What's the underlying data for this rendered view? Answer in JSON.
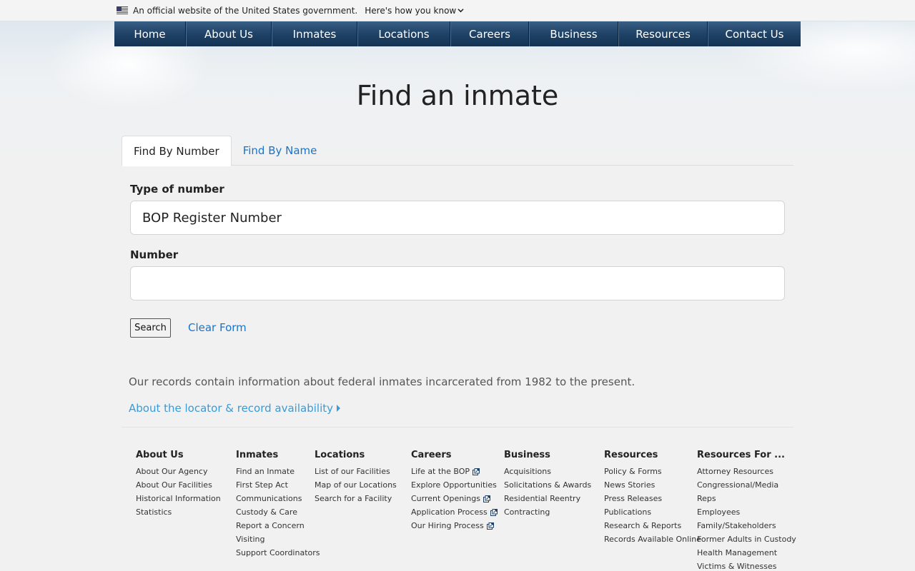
{
  "gov_banner": {
    "text": "An official website of the United States government.",
    "link": "Here's how you know"
  },
  "nav": [
    "Home",
    "About Us",
    "Inmates",
    "Locations",
    "Careers",
    "Business",
    "Resources",
    "Contact Us"
  ],
  "page_title": "Find an inmate",
  "tabs": {
    "by_number": "Find By Number",
    "by_name": "Find By Name"
  },
  "form": {
    "type_label": "Type of number",
    "type_value": "BOP Register Number",
    "number_label": "Number",
    "number_value": "",
    "search_button": "Search",
    "clear_link": "Clear Form"
  },
  "info": {
    "records": "Our records contain information about federal inmates incarcerated from 1982 to the present.",
    "locator_link": "About the locator & record availability"
  },
  "footer": [
    {
      "heading": "About Us",
      "links": [
        {
          "label": "About Our Agency"
        },
        {
          "label": "About Our Facilities"
        },
        {
          "label": "Historical Information"
        },
        {
          "label": "Statistics"
        }
      ]
    },
    {
      "heading": "Inmates",
      "links": [
        {
          "label": "Find an Inmate"
        },
        {
          "label": "First Step Act"
        },
        {
          "label": "Communications"
        },
        {
          "label": "Custody & Care"
        },
        {
          "label": "Report a Concern"
        },
        {
          "label": "Visiting"
        },
        {
          "label": "Support Coordinators"
        }
      ]
    },
    {
      "heading": "Locations",
      "links": [
        {
          "label": "List of our Facilities"
        },
        {
          "label": "Map of our Locations"
        },
        {
          "label": "Search for a Facility"
        }
      ]
    },
    {
      "heading": "Careers",
      "links": [
        {
          "label": "Life at the BOP",
          "external": true
        },
        {
          "label": "Explore Opportunities"
        },
        {
          "label": "Current Openings",
          "external": true
        },
        {
          "label": "Application Process",
          "external": true
        },
        {
          "label": "Our Hiring Process",
          "external": true
        }
      ]
    },
    {
      "heading": "Business",
      "links": [
        {
          "label": "Acquisitions"
        },
        {
          "label": "Solicitations & Awards"
        },
        {
          "label": "Residential Reentry"
        },
        {
          "label": "Contracting"
        }
      ]
    },
    {
      "heading": "Resources",
      "links": [
        {
          "label": "Policy & Forms"
        },
        {
          "label": "News Stories"
        },
        {
          "label": "Press Releases"
        },
        {
          "label": "Publications"
        },
        {
          "label": "Research & Reports"
        },
        {
          "label": "Records Available Online"
        }
      ]
    },
    {
      "heading": "Resources For ...",
      "links": [
        {
          "label": "Attorney Resources"
        },
        {
          "label": "Congressional/Media"
        },
        {
          "label": "Reps"
        },
        {
          "label": "Employees"
        },
        {
          "label": "Family/Stakeholders"
        },
        {
          "label": "Former Adults in Custody"
        },
        {
          "label": "Health Management"
        },
        {
          "label": "Victims & Witnesses"
        }
      ]
    }
  ],
  "colors": {
    "nav_bg": "#1f4266",
    "link": "#1a73c9",
    "locator_link": "#3a9bd5"
  }
}
